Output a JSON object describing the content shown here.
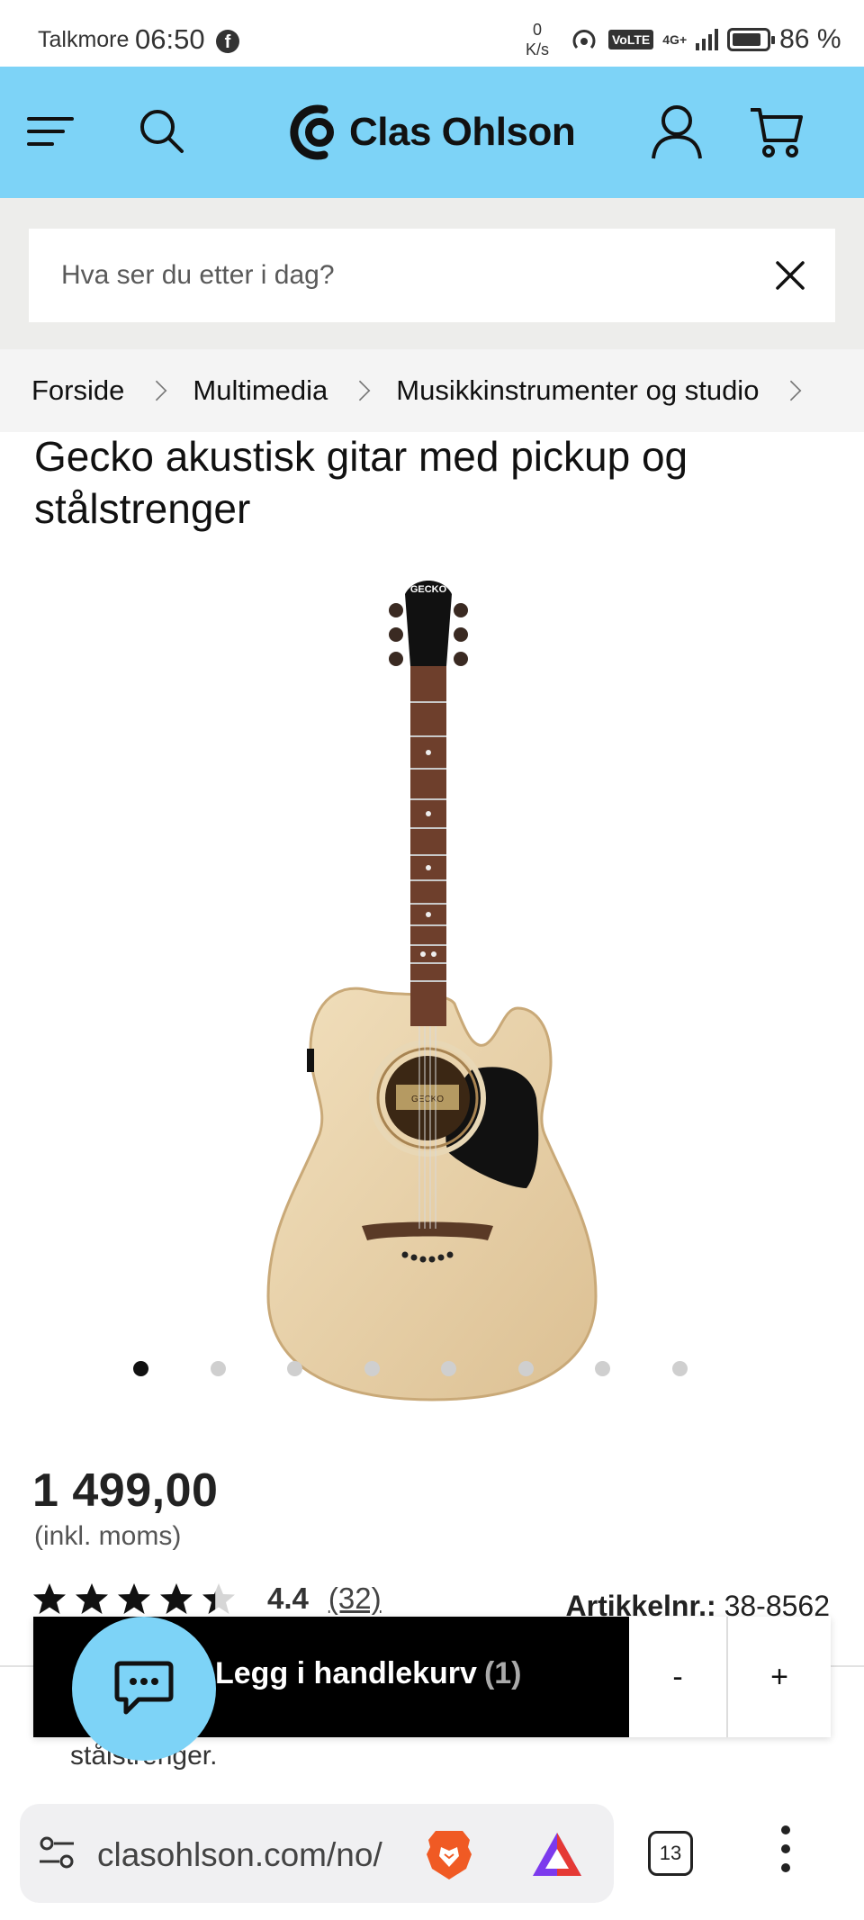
{
  "status_bar": {
    "carrier": "Talkmore",
    "time": "06:50",
    "speed_value": "0",
    "speed_unit": "K/s",
    "network": "4G+",
    "volte": "VoLTE",
    "battery_percent": "86 %",
    "battery_level": 0.86
  },
  "header": {
    "logo_text": "Clas Ohlson",
    "background_color": "#7dd3f7"
  },
  "search": {
    "placeholder": "Hva ser du etter i dag?"
  },
  "breadcrumb": {
    "items": [
      "Forside",
      "Multimedia",
      "Musikkinstrumenter og studio"
    ]
  },
  "product": {
    "title": "Gecko akustisk gitar med pickup og stålstrenger",
    "image_brand_text": "GECKO",
    "gallery_count": 8,
    "gallery_active_index": 0,
    "price": "1 499,00",
    "vat_note": "(inkl. moms)",
    "rating_value": "4.4",
    "rating_count": "(32)",
    "rating_stars": 4.4,
    "sku_label": "Artikkelnr.:",
    "sku_value": "38-8562",
    "description_fragment": "stålstrenger."
  },
  "cart": {
    "add_label": "Legg i handlekurv",
    "add_count": "(1)",
    "minus": "-",
    "plus": "+"
  },
  "browser": {
    "url": "clasohlson.com/no/",
    "tab_count": "13"
  },
  "icons": {
    "menu": "menu-icon",
    "search": "search-icon",
    "user": "user-icon",
    "cart": "cart-icon",
    "close": "close-icon",
    "chat": "chat-icon",
    "star": "star-icon"
  }
}
